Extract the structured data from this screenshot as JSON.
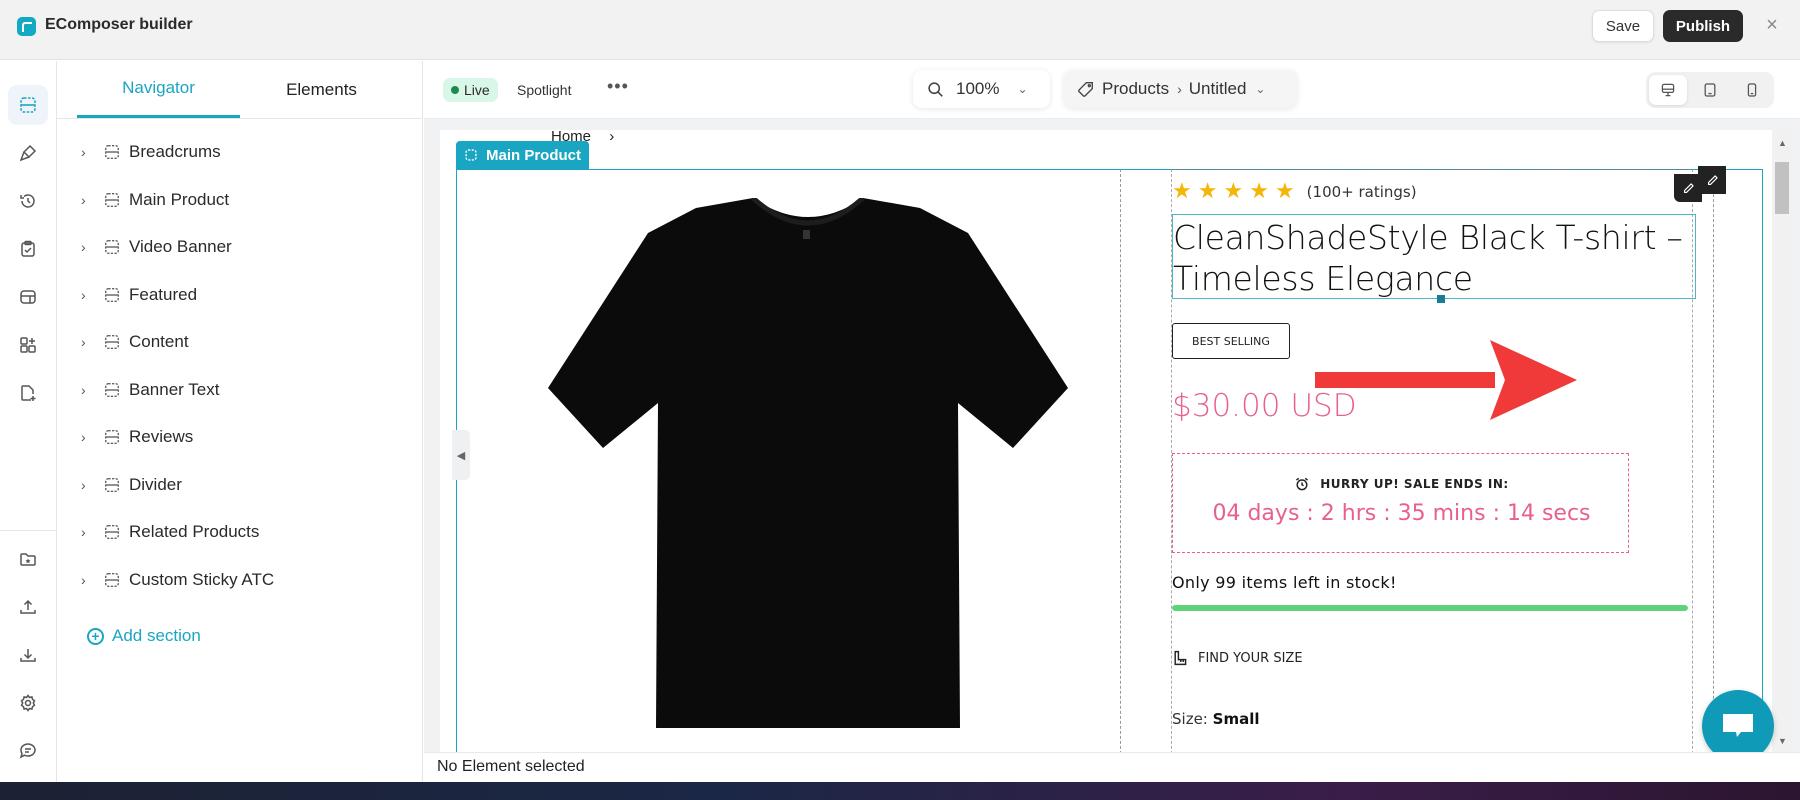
{
  "app": {
    "title": "EComposer builder",
    "save_label": "Save",
    "publish_label": "Publish",
    "close_symbol": "×"
  },
  "rail": {
    "top_icons": [
      "sections-icon",
      "brush-icon",
      "history-icon",
      "clipboard-check-icon",
      "layout-icon",
      "add-widget-icon",
      "add-page-icon"
    ],
    "bottom_icons": [
      "folder-star-icon",
      "upload-icon",
      "download-icon",
      "settings-icon",
      "feedback-icon"
    ]
  },
  "navigator": {
    "tabs": [
      {
        "label": "Navigator",
        "active": true
      },
      {
        "label": "Elements",
        "active": false
      }
    ],
    "items": [
      {
        "label": "Breadcrums"
      },
      {
        "label": "Main Product"
      },
      {
        "label": "Video Banner"
      },
      {
        "label": "Featured"
      },
      {
        "label": "Content"
      },
      {
        "label": "Banner Text"
      },
      {
        "label": "Reviews"
      },
      {
        "label": "Divider"
      },
      {
        "label": "Related Products"
      },
      {
        "label": "Custom Sticky ATC"
      }
    ],
    "add_section_label": "Add section"
  },
  "toolbar": {
    "live_label": "Live",
    "spotlight_label": "Spotlight",
    "more_symbol": "•••",
    "zoom_value": "100%",
    "page_type": "Products",
    "page_name": "Untitled",
    "devices": [
      {
        "name": "desktop",
        "active": true
      },
      {
        "name": "tablet",
        "active": false
      },
      {
        "name": "mobile",
        "active": false
      }
    ]
  },
  "canvas": {
    "breadcrumb_home": "Home",
    "breadcrumb_sep": "›",
    "section_tag": "Main Product",
    "product": {
      "stars": 5,
      "rating_text": "(100+ ratings)",
      "title": "CleanShadeStyle Black T-shirt – Timeless Elegance",
      "badge": "BEST SELLING",
      "price": "$30.00 USD",
      "timer_label": "HURRY UP! SALE ENDS IN:",
      "timer_value": "04 days : 2 hrs : 35 mins : 14 secs",
      "stock_text": "Only 99 items left in stock!",
      "stock_fill_percent": 100,
      "find_size_label": "FIND YOUR SIZE",
      "size_label": "Size:",
      "size_value": "Small"
    }
  },
  "status": {
    "text": "No Element selected"
  },
  "colors": {
    "accent": "#1aa6c2",
    "price_pink": "#e8608f",
    "star": "#f5b60a",
    "stock_green": "#5fd27a",
    "annotation_red": "#f03a3a"
  }
}
